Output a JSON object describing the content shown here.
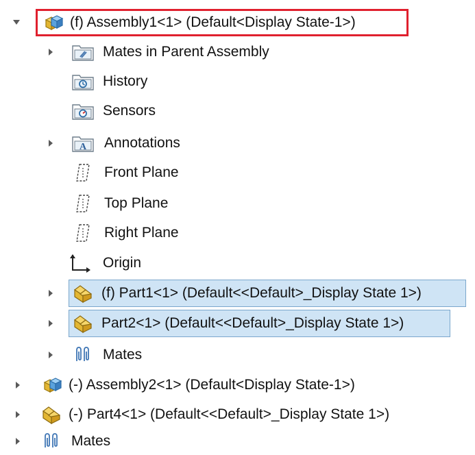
{
  "tree": {
    "root": {
      "label": "(f) Assembly1<1> (Default<Display State-1>)",
      "icon": "assembly-icon",
      "expanded": true,
      "highlight_color": "#e0202e"
    },
    "children": [
      {
        "label": "Mates in Parent Assembly",
        "icon": "folder-mates-icon"
      },
      {
        "label": "History",
        "icon": "folder-history-icon"
      },
      {
        "label": "Sensors",
        "icon": "folder-sensors-icon"
      },
      {
        "label": "Annotations",
        "icon": "folder-annotations-icon"
      },
      {
        "label": "Front Plane",
        "icon": "plane-icon"
      },
      {
        "label": "Top Plane",
        "icon": "plane-icon"
      },
      {
        "label": "Right Plane",
        "icon": "plane-icon"
      },
      {
        "label": "Origin",
        "icon": "origin-icon"
      },
      {
        "label": "(f) Part1<1> (Default<<Default>_Display State 1>)",
        "icon": "part-icon",
        "selected": true
      },
      {
        "label": "Part2<1> (Default<<Default>_Display State 1>)",
        "icon": "part-icon",
        "selected": true
      },
      {
        "label": "Mates",
        "icon": "mates-icon"
      }
    ],
    "siblings": [
      {
        "label": "(-) Assembly2<1> (Default<Display State-1>)",
        "icon": "assembly-icon"
      },
      {
        "label": "(-) Part4<1> (Default<<Default>_Display State 1>)",
        "icon": "part-icon"
      },
      {
        "label": "Mates",
        "icon": "mates-icon"
      }
    ],
    "selection_color": "#cfe4f5"
  }
}
